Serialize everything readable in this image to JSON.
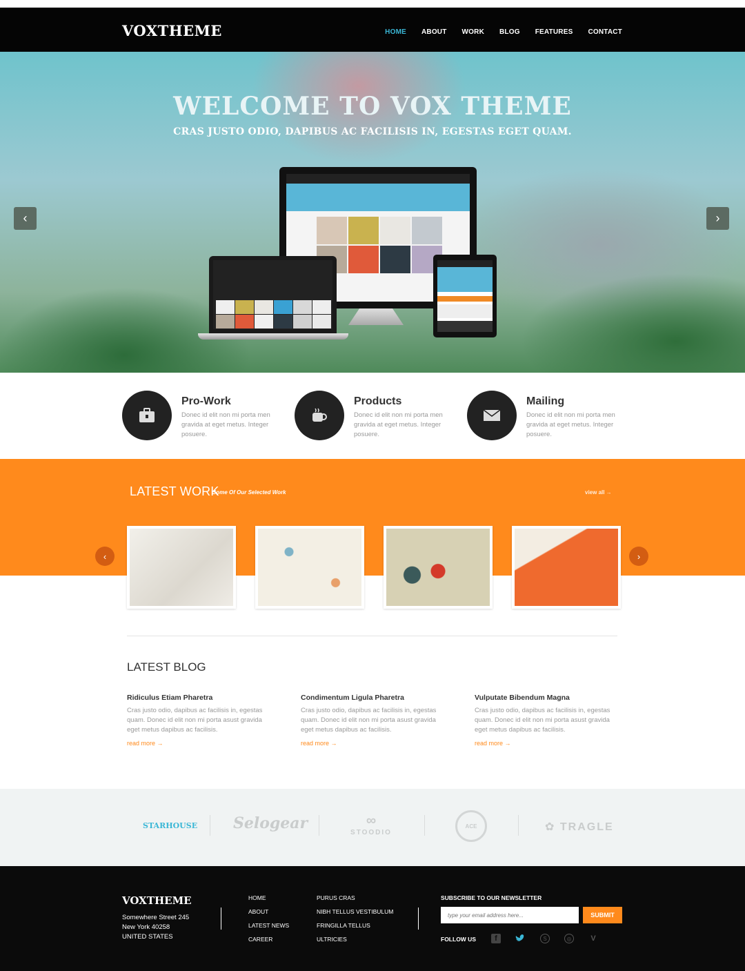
{
  "header": {
    "logo": "VOXTHEME",
    "nav": [
      "HOME",
      "ABOUT",
      "WORK",
      "BLOG",
      "FEATURES",
      "CONTACT"
    ],
    "active": "HOME"
  },
  "hero": {
    "title": "WELCOME TO VOX THEME",
    "subtitle": "CRAS JUSTO ODIO, DAPIBUS AC FACILISIS IN, EGESTAS EGET QUAM.",
    "prev_icon": "chevron-left-icon",
    "next_icon": "chevron-right-icon"
  },
  "features": [
    {
      "title": "Pro-Work",
      "icon": "briefcase-icon",
      "text": "Donec id elit non mi porta men gravida at eget metus. Integer posuere."
    },
    {
      "title": "Products",
      "icon": "coffee-cup-icon",
      "text": "Donec id elit non mi porta men gravida at eget metus. Integer posuere."
    },
    {
      "title": "Mailing",
      "icon": "envelope-icon",
      "text": "Donec id elit non mi porta men gravida at eget metus. Integer posuere."
    }
  ],
  "latest_work": {
    "title": "LATEST WORK",
    "subtitle": "Some Of Our Selected Work",
    "view_all": "view all →",
    "thumbs": [
      {
        "color": "#e9e6df"
      },
      {
        "color": "#f3efe4"
      },
      {
        "color": "#cfc8a8"
      },
      {
        "color": "#ef6a2e"
      }
    ]
  },
  "latest_blog": {
    "title": "LATEST BLOG",
    "posts": [
      {
        "title": "Ridiculus Etiam Pharetra",
        "text": "Cras justo odio, dapibus ac facilisis in, egestas quam. Donec id elit non mi porta asust gravida eget metus dapibus ac facilisis.",
        "link": "read more →"
      },
      {
        "title": "Condimentum Ligula Pharetra",
        "text": "Cras justo odio, dapibus ac facilisis in, egestas quam. Donec id elit non mi porta asust gravida eget metus dapibus ac facilisis.",
        "link": "read more →"
      },
      {
        "title": "Vulputate Bibendum Magna",
        "text": "Cras justo odio, dapibus ac facilisis in, egestas quam. Donec id elit non mi porta asust gravida eget metus dapibus ac facilisis.",
        "link": "read more →"
      }
    ]
  },
  "clients": [
    "STARHOUSE",
    "Selogear",
    "STOODIO",
    "ACE",
    "TRAGLE"
  ],
  "footer": {
    "logo": "VOXTHEME",
    "address": [
      "Somewhere Street 245",
      "New York 40258",
      "UNITED STATES"
    ],
    "col1": [
      "HOME",
      "ABOUT",
      "LATEST NEWS",
      "CAREER"
    ],
    "col2": [
      "PURUS CRAS",
      "NIBH TELLUS VESTIBULUM",
      "FRINGILLA TELLUS",
      "ULTRICIES"
    ],
    "newsletter_title": "SUBSCRIBE TO OUR NEWSLETTER",
    "newsletter_placeholder": "type your email address here...",
    "submit": "SUBMIT",
    "follow": "FOLLOW US",
    "social": [
      "facebook-icon",
      "twitter-icon",
      "skype-icon",
      "dribbble-icon",
      "vimeo-icon"
    ]
  },
  "colors": {
    "accent": "#ff8a1c",
    "nav_active": "#3bb7d6",
    "dark": "#050505"
  }
}
